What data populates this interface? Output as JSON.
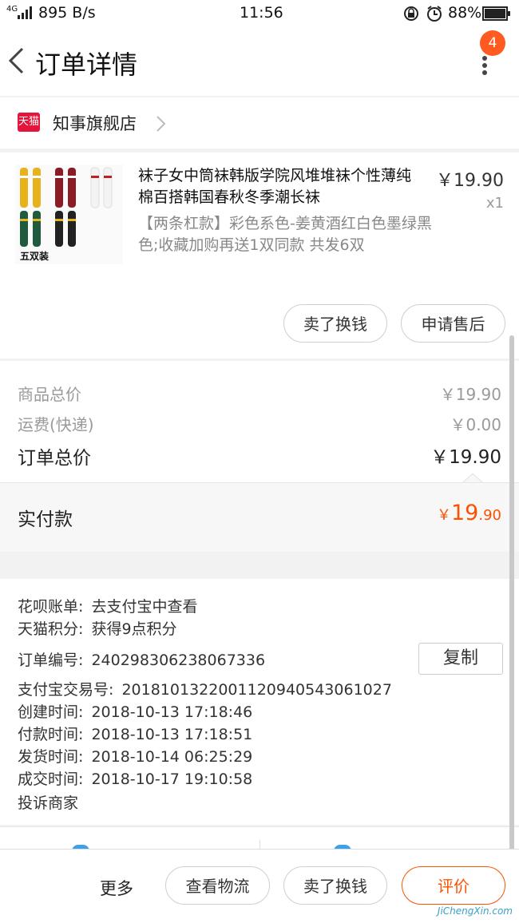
{
  "status_bar": {
    "network": "4G",
    "speed": "895 B/s",
    "time": "11:56",
    "battery": "88%"
  },
  "header": {
    "title": "订单详情",
    "badge_count": "4"
  },
  "shop": {
    "badge": "天猫",
    "name": "知事旗舰店"
  },
  "product": {
    "title": "袜子女中筒袜韩版学院风堆堆袜个性薄纯棉百搭韩国春秋冬季潮长袜",
    "variant": "【两条杠款】彩色系色-姜黄酒红白色墨绿黑色;收藏加购再送1双同款 共发6双",
    "price": "￥19.90",
    "quantity": "x1",
    "thumb_caption": "五双装",
    "buttons": [
      "卖了换钱",
      "申请售后"
    ]
  },
  "prices": {
    "rows": [
      {
        "label": "商品总价",
        "value": "￥19.90"
      },
      {
        "label": "运费(快递)",
        "value": "￥0.00"
      },
      {
        "label": "订单总价",
        "value": "￥19.90"
      }
    ],
    "paid_label": "实付款",
    "paid_currency": "￥",
    "paid_int": "19",
    "paid_dec": ".90"
  },
  "info": {
    "rows": [
      {
        "key": "花呗账单:",
        "value": "去支付宝中查看"
      },
      {
        "key": "天猫积分:",
        "value": "获得9点积分"
      },
      {
        "key": "订单编号:",
        "value": "240298306238067336"
      },
      {
        "key": "支付宝交易号:",
        "value": "2018101322001120940543061027"
      },
      {
        "key": "创建时间:",
        "value": "2018-10-13 17:18:46"
      },
      {
        "key": "付款时间:",
        "value": "2018-10-13 17:18:51"
      },
      {
        "key": "发货时间:",
        "value": "2018-10-14 06:25:29"
      },
      {
        "key": "成交时间:",
        "value": "2018-10-17 19:10:58"
      }
    ],
    "complain": "投诉商家",
    "copy_label": "复制"
  },
  "bottom_bar": {
    "more": "更多",
    "buttons": [
      "查看物流",
      "卖了换钱",
      "评价"
    ]
  },
  "watermark": "JiChengXin.com",
  "colors": {
    "accent": "#ff5000",
    "tmall": "#e4143c",
    "badge": "#ff5a1f"
  }
}
